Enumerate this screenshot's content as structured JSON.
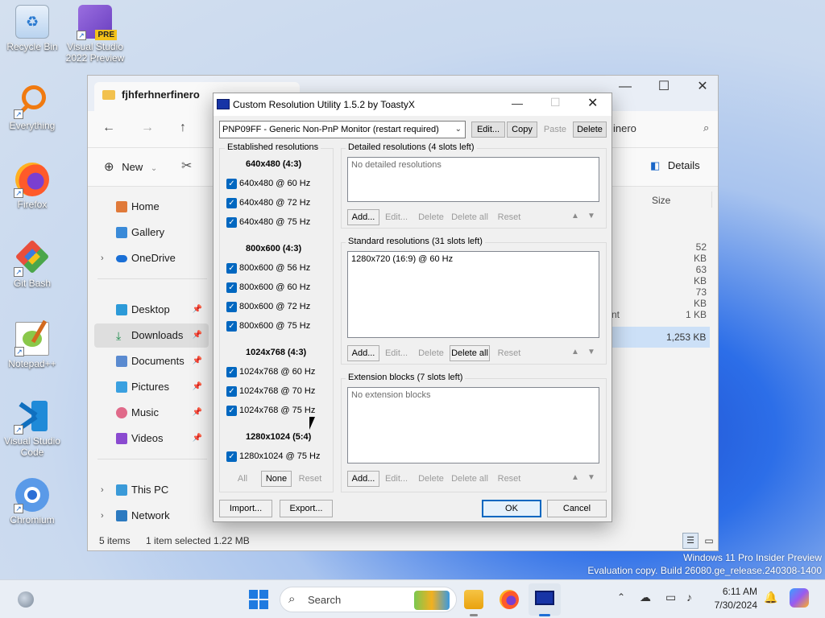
{
  "desktop": {
    "icons": [
      {
        "label": "Recycle Bin",
        "icon": "recycle-bin-icon"
      },
      {
        "label": "Visual Studio 2022 Preview",
        "badge": "PRE",
        "icon": "visual-studio-icon"
      },
      {
        "label": "Everything",
        "icon": "everything-search-icon"
      },
      {
        "label": "Firefox",
        "icon": "firefox-icon"
      },
      {
        "label": "Git Bash",
        "icon": "git-bash-icon"
      },
      {
        "label": "Notepad++",
        "icon": "notepad-plus-plus-icon"
      },
      {
        "label": "Visual Studio Code",
        "icon": "vscode-icon"
      },
      {
        "label": "Chromium",
        "icon": "chromium-icon"
      }
    ]
  },
  "explorer": {
    "tab_title": "fjhferhnerfinero",
    "address_partial": "inero",
    "toolbar": {
      "new_label": "New",
      "details_label": "Details"
    },
    "column_size": "Size",
    "nav": [
      {
        "label": "Home"
      },
      {
        "label": "Gallery"
      },
      {
        "label": "OneDrive"
      },
      {
        "label": "Desktop"
      },
      {
        "label": "Downloads"
      },
      {
        "label": "Documents"
      },
      {
        "label": "Pictures"
      },
      {
        "label": "Music"
      },
      {
        "label": "Videos"
      },
      {
        "label": "This PC"
      },
      {
        "label": "Network"
      }
    ],
    "sizes": [
      "52 KB",
      "63 KB",
      "73 KB",
      "1 KB",
      "1,253 KB"
    ],
    "partial_name": "nt",
    "status": {
      "items": "5 items",
      "selected": "1 item selected  1.22 MB"
    }
  },
  "cru": {
    "title": "Custom Resolution Utility 1.5.2 by ToastyX",
    "monitor": "PNP09FF - Generic Non-PnP Monitor (restart required)",
    "top_buttons": {
      "edit": "Edit...",
      "copy": "Copy",
      "paste": "Paste",
      "delete": "Delete"
    },
    "established": {
      "label": "Established resolutions",
      "groups": [
        {
          "head": "640x480 (4:3)",
          "items": [
            "640x480 @ 60 Hz",
            "640x480 @ 72 Hz",
            "640x480 @ 75 Hz"
          ]
        },
        {
          "head": "800x600 (4:3)",
          "items": [
            "800x600 @ 56 Hz",
            "800x600 @ 60 Hz",
            "800x600 @ 72 Hz",
            "800x600 @ 75 Hz"
          ]
        },
        {
          "head": "1024x768 (4:3)",
          "items": [
            "1024x768 @ 60 Hz",
            "1024x768 @ 70 Hz",
            "1024x768 @ 75 Hz"
          ]
        },
        {
          "head": "1280x1024 (5:4)",
          "items": [
            "1280x1024 @ 75 Hz"
          ]
        }
      ],
      "buttons": {
        "all": "All",
        "none": "None",
        "reset": "Reset"
      }
    },
    "detailed": {
      "label": "Detailed resolutions (4 slots left)",
      "empty": "No detailed resolutions"
    },
    "standard": {
      "label": "Standard resolutions (31 slots left)",
      "items": [
        "1280x720 (16:9) @ 60 Hz"
      ]
    },
    "extension": {
      "label": "Extension blocks (7 slots left)",
      "empty": "No extension blocks"
    },
    "section_buttons": {
      "add": "Add...",
      "edit": "Edit...",
      "delete": "Delete",
      "delete_all": "Delete all",
      "reset": "Reset"
    },
    "bottom": {
      "import": "Import...",
      "export": "Export...",
      "ok": "OK",
      "cancel": "Cancel"
    }
  },
  "watermark": {
    "line1": "Windows 11 Pro Insider Preview",
    "line2": "Evaluation copy. Build 26080.ge_release.240308-1400"
  },
  "taskbar": {
    "search_placeholder": "Search",
    "time": "6:11 AM",
    "date": "7/30/2024"
  }
}
